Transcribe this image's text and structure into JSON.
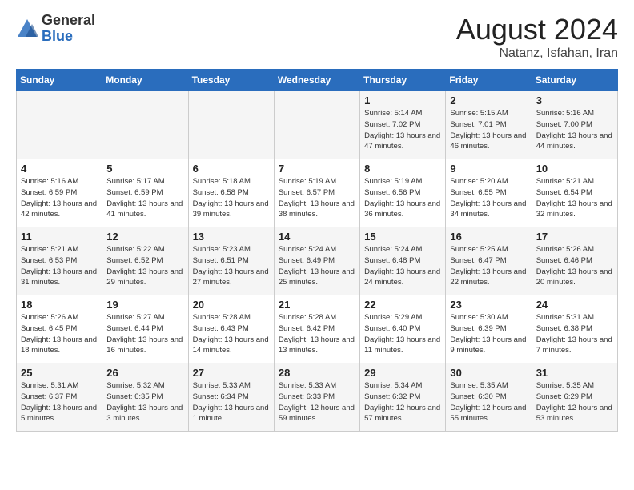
{
  "header": {
    "logo_general": "General",
    "logo_blue": "Blue",
    "month_title": "August 2024",
    "location": "Natanz, Isfahan, Iran"
  },
  "days_of_week": [
    "Sunday",
    "Monday",
    "Tuesday",
    "Wednesday",
    "Thursday",
    "Friday",
    "Saturday"
  ],
  "weeks": [
    [
      {
        "day": "",
        "info": ""
      },
      {
        "day": "",
        "info": ""
      },
      {
        "day": "",
        "info": ""
      },
      {
        "day": "",
        "info": ""
      },
      {
        "day": "1",
        "info": "Sunrise: 5:14 AM\nSunset: 7:02 PM\nDaylight: 13 hours\nand 47 minutes."
      },
      {
        "day": "2",
        "info": "Sunrise: 5:15 AM\nSunset: 7:01 PM\nDaylight: 13 hours\nand 46 minutes."
      },
      {
        "day": "3",
        "info": "Sunrise: 5:16 AM\nSunset: 7:00 PM\nDaylight: 13 hours\nand 44 minutes."
      }
    ],
    [
      {
        "day": "4",
        "info": "Sunrise: 5:16 AM\nSunset: 6:59 PM\nDaylight: 13 hours\nand 42 minutes."
      },
      {
        "day": "5",
        "info": "Sunrise: 5:17 AM\nSunset: 6:59 PM\nDaylight: 13 hours\nand 41 minutes."
      },
      {
        "day": "6",
        "info": "Sunrise: 5:18 AM\nSunset: 6:58 PM\nDaylight: 13 hours\nand 39 minutes."
      },
      {
        "day": "7",
        "info": "Sunrise: 5:19 AM\nSunset: 6:57 PM\nDaylight: 13 hours\nand 38 minutes."
      },
      {
        "day": "8",
        "info": "Sunrise: 5:19 AM\nSunset: 6:56 PM\nDaylight: 13 hours\nand 36 minutes."
      },
      {
        "day": "9",
        "info": "Sunrise: 5:20 AM\nSunset: 6:55 PM\nDaylight: 13 hours\nand 34 minutes."
      },
      {
        "day": "10",
        "info": "Sunrise: 5:21 AM\nSunset: 6:54 PM\nDaylight: 13 hours\nand 32 minutes."
      }
    ],
    [
      {
        "day": "11",
        "info": "Sunrise: 5:21 AM\nSunset: 6:53 PM\nDaylight: 13 hours\nand 31 minutes."
      },
      {
        "day": "12",
        "info": "Sunrise: 5:22 AM\nSunset: 6:52 PM\nDaylight: 13 hours\nand 29 minutes."
      },
      {
        "day": "13",
        "info": "Sunrise: 5:23 AM\nSunset: 6:51 PM\nDaylight: 13 hours\nand 27 minutes."
      },
      {
        "day": "14",
        "info": "Sunrise: 5:24 AM\nSunset: 6:49 PM\nDaylight: 13 hours\nand 25 minutes."
      },
      {
        "day": "15",
        "info": "Sunrise: 5:24 AM\nSunset: 6:48 PM\nDaylight: 13 hours\nand 24 minutes."
      },
      {
        "day": "16",
        "info": "Sunrise: 5:25 AM\nSunset: 6:47 PM\nDaylight: 13 hours\nand 22 minutes."
      },
      {
        "day": "17",
        "info": "Sunrise: 5:26 AM\nSunset: 6:46 PM\nDaylight: 13 hours\nand 20 minutes."
      }
    ],
    [
      {
        "day": "18",
        "info": "Sunrise: 5:26 AM\nSunset: 6:45 PM\nDaylight: 13 hours\nand 18 minutes."
      },
      {
        "day": "19",
        "info": "Sunrise: 5:27 AM\nSunset: 6:44 PM\nDaylight: 13 hours\nand 16 minutes."
      },
      {
        "day": "20",
        "info": "Sunrise: 5:28 AM\nSunset: 6:43 PM\nDaylight: 13 hours\nand 14 minutes."
      },
      {
        "day": "21",
        "info": "Sunrise: 5:28 AM\nSunset: 6:42 PM\nDaylight: 13 hours\nand 13 minutes."
      },
      {
        "day": "22",
        "info": "Sunrise: 5:29 AM\nSunset: 6:40 PM\nDaylight: 13 hours\nand 11 minutes."
      },
      {
        "day": "23",
        "info": "Sunrise: 5:30 AM\nSunset: 6:39 PM\nDaylight: 13 hours\nand 9 minutes."
      },
      {
        "day": "24",
        "info": "Sunrise: 5:31 AM\nSunset: 6:38 PM\nDaylight: 13 hours\nand 7 minutes."
      }
    ],
    [
      {
        "day": "25",
        "info": "Sunrise: 5:31 AM\nSunset: 6:37 PM\nDaylight: 13 hours\nand 5 minutes."
      },
      {
        "day": "26",
        "info": "Sunrise: 5:32 AM\nSunset: 6:35 PM\nDaylight: 13 hours\nand 3 minutes."
      },
      {
        "day": "27",
        "info": "Sunrise: 5:33 AM\nSunset: 6:34 PM\nDaylight: 13 hours\nand 1 minute."
      },
      {
        "day": "28",
        "info": "Sunrise: 5:33 AM\nSunset: 6:33 PM\nDaylight: 12 hours\nand 59 minutes."
      },
      {
        "day": "29",
        "info": "Sunrise: 5:34 AM\nSunset: 6:32 PM\nDaylight: 12 hours\nand 57 minutes."
      },
      {
        "day": "30",
        "info": "Sunrise: 5:35 AM\nSunset: 6:30 PM\nDaylight: 12 hours\nand 55 minutes."
      },
      {
        "day": "31",
        "info": "Sunrise: 5:35 AM\nSunset: 6:29 PM\nDaylight: 12 hours\nand 53 minutes."
      }
    ]
  ]
}
